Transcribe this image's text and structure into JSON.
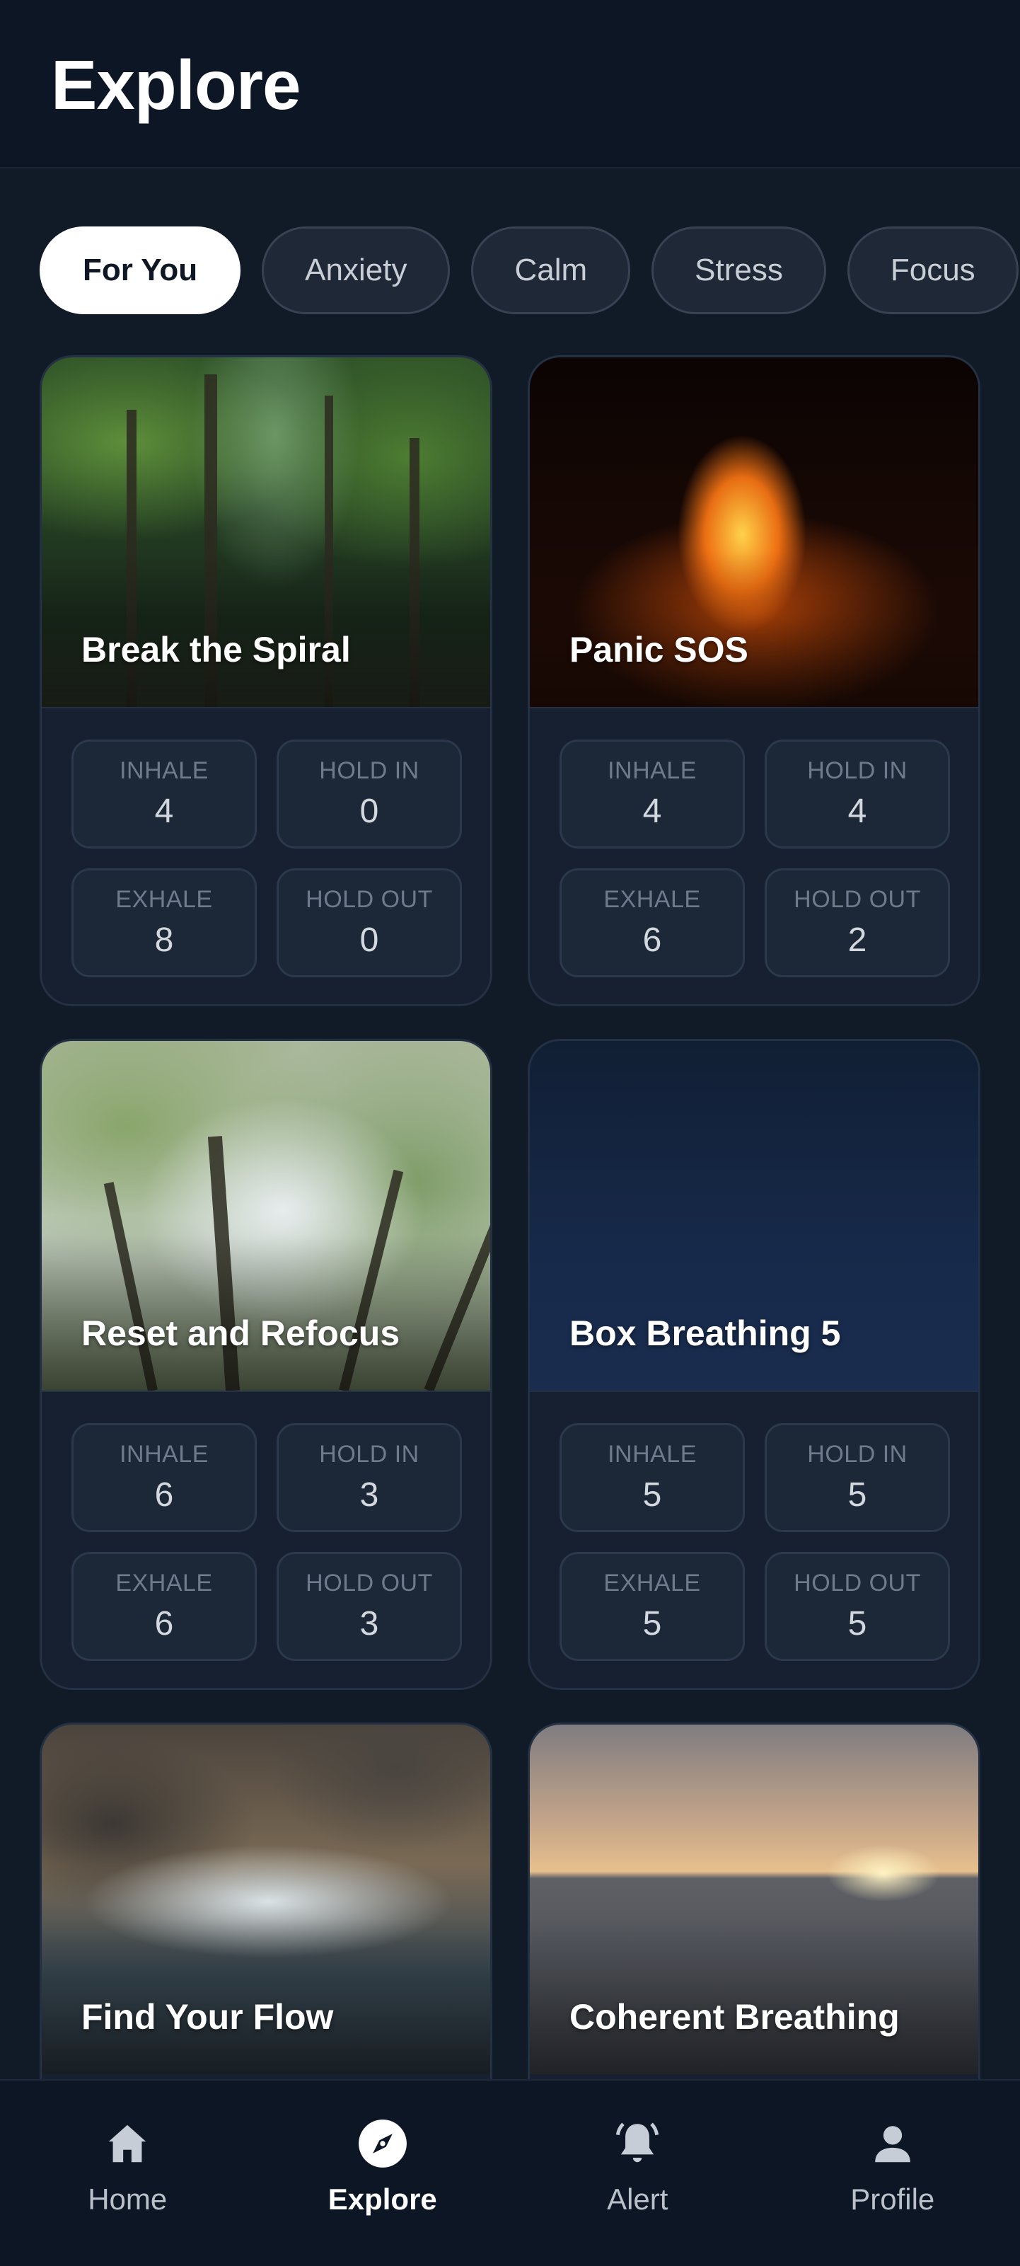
{
  "header": {
    "title": "Explore"
  },
  "chips": [
    {
      "label": "For You",
      "active": true
    },
    {
      "label": "Anxiety",
      "active": false
    },
    {
      "label": "Calm",
      "active": false
    },
    {
      "label": "Stress",
      "active": false
    },
    {
      "label": "Focus",
      "active": false
    }
  ],
  "cards": [
    {
      "title": "Break the Spiral",
      "inhale": "4",
      "hold_in": "0",
      "exhale": "8",
      "hold_out": "0",
      "scene": "forest"
    },
    {
      "title": "Panic SOS",
      "inhale": "4",
      "hold_in": "4",
      "exhale": "6",
      "hold_out": "2",
      "scene": "fire"
    },
    {
      "title": "Reset and Refocus",
      "inhale": "6",
      "hold_in": "3",
      "exhale": "6",
      "hold_out": "3",
      "scene": "canopy"
    },
    {
      "title": "Box Breathing 5",
      "inhale": "5",
      "hold_in": "5",
      "exhale": "5",
      "hold_out": "5",
      "scene": "night"
    },
    {
      "title": "Find Your Flow",
      "scene": "river"
    },
    {
      "title": "Coherent Breathing",
      "scene": "beach"
    }
  ],
  "labels": {
    "inhale": "INHALE",
    "hold_in": "HOLD IN",
    "exhale": "EXHALE",
    "hold_out": "HOLD OUT"
  },
  "nav": [
    {
      "label": "Home",
      "icon": "home-icon",
      "active": false
    },
    {
      "label": "Explore",
      "icon": "compass-icon",
      "active": true
    },
    {
      "label": "Alert",
      "icon": "bell-icon",
      "active": false
    },
    {
      "label": "Profile",
      "icon": "user-icon",
      "active": false
    }
  ]
}
